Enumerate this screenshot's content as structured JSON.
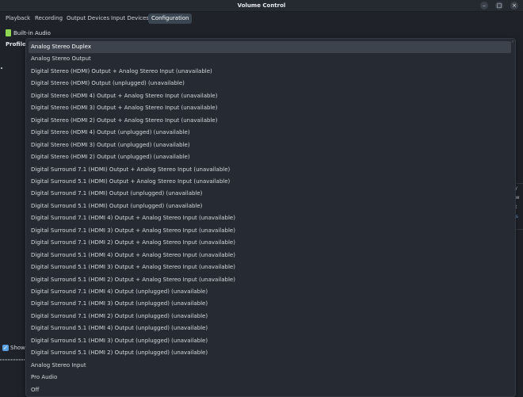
{
  "window": {
    "title": "Volume Control"
  },
  "tabs": [
    "Playback",
    "Recording",
    "Output Devices",
    "Input Devices",
    "Configuration"
  ],
  "active_tab": "Configuration",
  "card": {
    "name": "Built-in Audio"
  },
  "profile_label": "Profile:",
  "profile_options": [
    "Analog Stereo Duplex",
    "Analog Stereo Output",
    "Digital Stereo (HDMI) Output + Analog Stereo Input (unavailable)",
    "Digital Stereo (HDMI) Output (unplugged) (unavailable)",
    "Digital Stereo (HDMI 4) Output + Analog Stereo Input (unavailable)",
    "Digital Stereo (HDMI 3) Output + Analog Stereo Input (unavailable)",
    "Digital Stereo (HDMI 2) Output + Analog Stereo Input (unavailable)",
    "Digital Stereo (HDMI 4) Output (unplugged) (unavailable)",
    "Digital Stereo (HDMI 3) Output (unplugged) (unavailable)",
    "Digital Stereo (HDMI 2) Output (unplugged) (unavailable)",
    "Digital Surround 7.1 (HDMI) Output + Analog Stereo Input (unavailable)",
    "Digital Surround 5.1 (HDMI) Output + Analog Stereo Input (unavailable)",
    "Digital Surround 7.1 (HDMI) Output (unplugged) (unavailable)",
    "Digital Surround 5.1 (HDMI) Output (unplugged) (unavailable)",
    "Digital Surround 7.1 (HDMI 4) Output + Analog Stereo Input (unavailable)",
    "Digital Surround 7.1 (HDMI 3) Output + Analog Stereo Input (unavailable)",
    "Digital Surround 7.1 (HDMI 2) Output + Analog Stereo Input (unavailable)",
    "Digital Surround 5.1 (HDMI 4) Output + Analog Stereo Input (unavailable)",
    "Digital Surround 5.1 (HDMI 3) Output + Analog Stereo Input (unavailable)",
    "Digital Surround 5.1 (HDMI 2) Output + Analog Stereo Input (unavailable)",
    "Digital Surround 7.1 (HDMI 4) Output (unplugged) (unavailable)",
    "Digital Surround 7.1 (HDMI 3) Output (unplugged) (unavailable)",
    "Digital Surround 7.1 (HDMI 2) Output (unplugged) (unavailable)",
    "Digital Surround 5.1 (HDMI 4) Output (unplugged) (unavailable)",
    "Digital Surround 5.1 (HDMI 3) Output (unplugged) (unavailable)",
    "Digital Surround 5.1 (HDMI 2) Output (unplugged) (unavailable)",
    "Analog Stereo Input",
    "Pro Audio",
    "Off"
  ],
  "selected_profile": "Analog Stereo Duplex",
  "show_checkbox": {
    "label": "Show",
    "checked": true
  },
  "side_fragments": [
    "ry",
    "ow",
    "st",
    "ns"
  ],
  "icons": {
    "window_buttons": [
      "minimize-icon",
      "maximize-icon",
      "close-icon"
    ],
    "card_icon": "audio-card-icon"
  },
  "colors": {
    "background": "#1f2329",
    "dropdown_bg": "#262b33",
    "selected_bg": "#3c434d",
    "active_tab_bg": "#3a4652",
    "card_icon": "#8fd651",
    "checkbox": "#5aa0e0",
    "link": "#6aa8e8"
  }
}
